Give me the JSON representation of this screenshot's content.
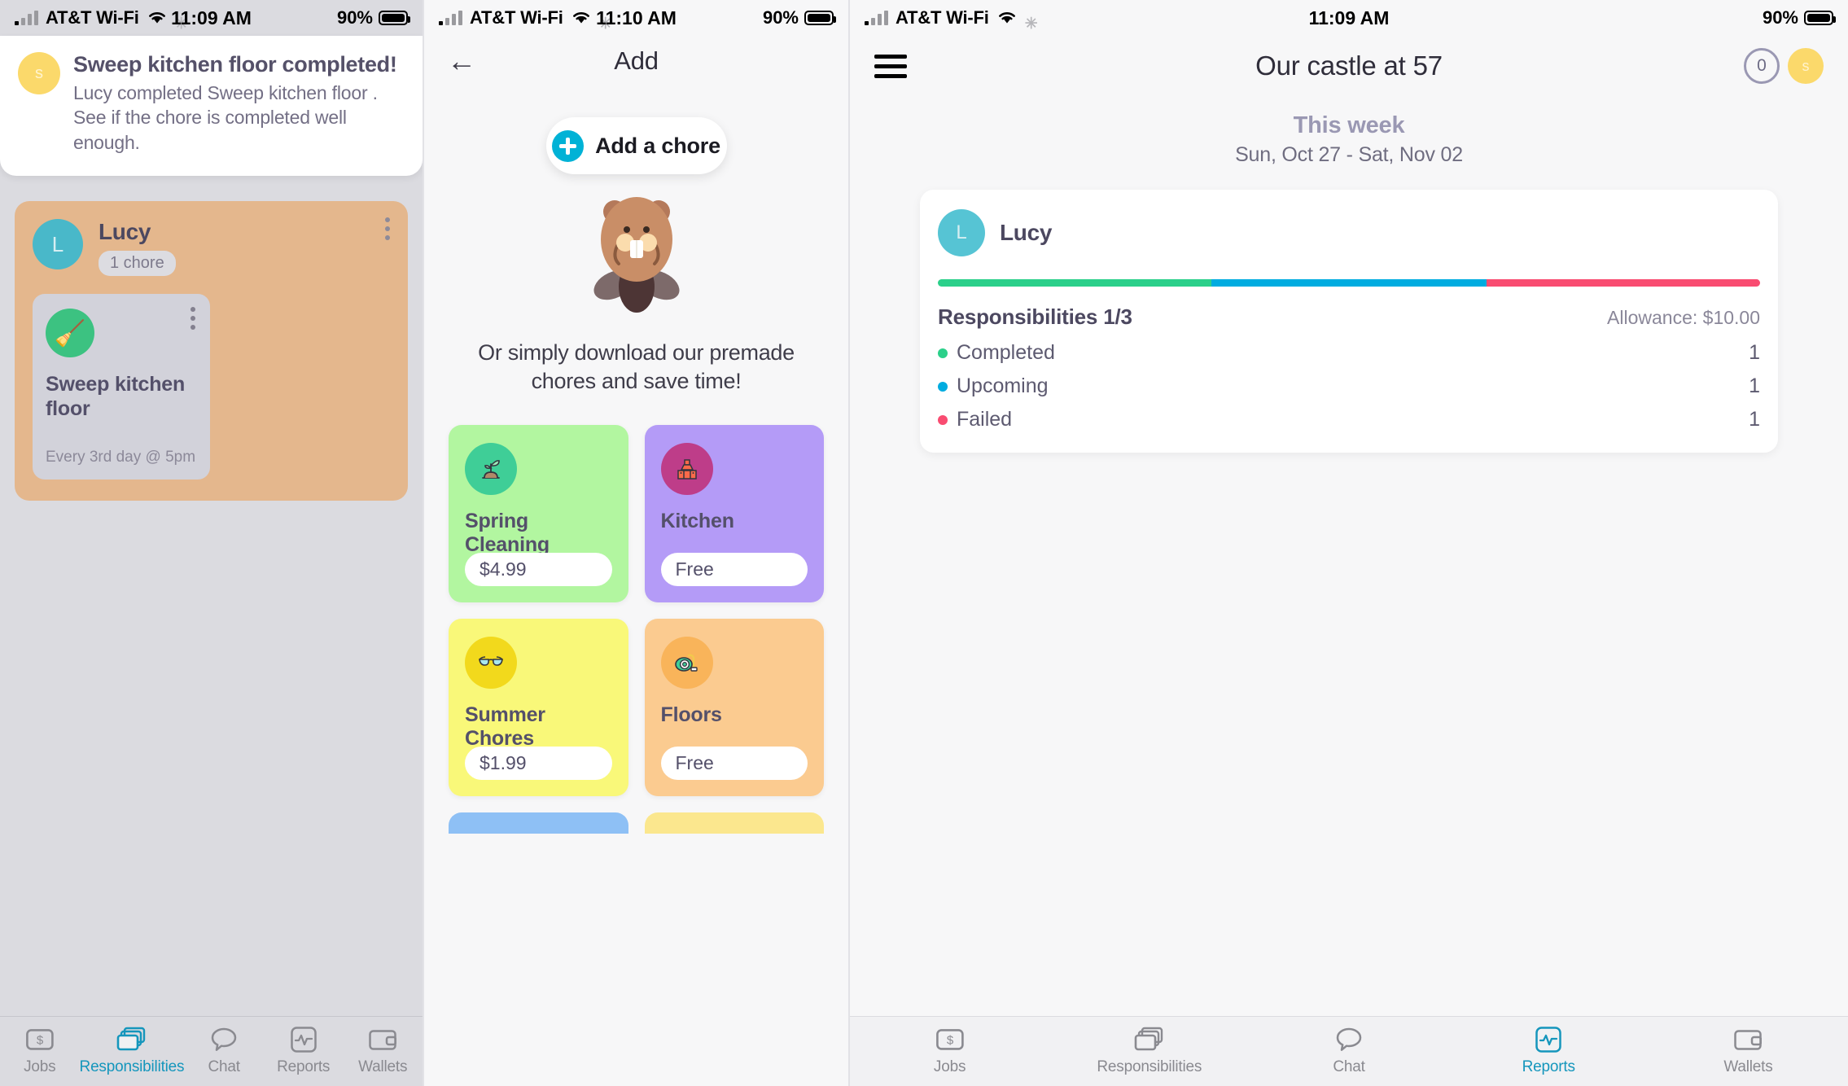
{
  "status_bars": [
    {
      "carrier": "AT&T Wi-Fi",
      "time": "11:09 AM",
      "battery": "90%"
    },
    {
      "carrier": "AT&T Wi-Fi",
      "time": "11:10 AM",
      "battery": "90%"
    },
    {
      "carrier": "AT&T Wi-Fi",
      "time": "11:09 AM",
      "battery": "90%"
    }
  ],
  "screen1": {
    "toast": {
      "avatar_initial": "s",
      "title": "Sweep kitchen floor  completed!",
      "body": "Lucy completed Sweep kitchen floor . See if the chore is completed well enough."
    },
    "member": {
      "avatar_initial": "L",
      "name": "Lucy",
      "chore_count": "1 chore",
      "card_color": "#e4b78d"
    },
    "chore": {
      "icon": "broom-icon",
      "icon_glyph": "🧹",
      "icon_bg": "#3cc281",
      "title": "Sweep kitchen floor",
      "schedule": "Every 3rd day @ 5pm"
    },
    "tabs": [
      {
        "label": "Jobs",
        "icon": "dollar-card-icon",
        "active": false
      },
      {
        "label": "Responsibilities",
        "icon": "stacked-cards-icon",
        "active": true
      },
      {
        "label": "Chat",
        "icon": "speech-bubble-icon",
        "active": false
      },
      {
        "label": "Reports",
        "icon": "pulse-chart-icon",
        "active": false
      },
      {
        "label": "Wallets",
        "icon": "wallet-icon",
        "active": false
      }
    ]
  },
  "screen2": {
    "nav": {
      "back_icon": "back-arrow-icon",
      "title": "Add"
    },
    "add_chore_button": {
      "label": "Add a chore",
      "icon": "plus-circle-icon"
    },
    "mascot": "beaver-mascot",
    "premade_text": "Or simply download our premade chores and save time!",
    "packs": [
      {
        "name": "Spring Cleaning",
        "price": "$4.99",
        "card_bg": "#b2f6a0",
        "icon_bg": "#3fce97",
        "icon": "sprout-icon",
        "icon_glyph": "🌱"
      },
      {
        "name": "Kitchen",
        "price": "Free",
        "card_bg": "#b49bf7",
        "icon_bg": "#be3d89",
        "icon": "kitchen-counter-icon",
        "icon_glyph": "🍳"
      },
      {
        "name": "Summer Chores",
        "price": "$1.99",
        "card_bg": "#f9f879",
        "icon_bg": "#f2d91c",
        "icon": "sunglasses-icon",
        "icon_glyph": "🕶"
      },
      {
        "name": "Floors",
        "price": "Free",
        "card_bg": "#fbcb90",
        "icon_bg": "#f9b košt",
        "icon": "vacuum-icon",
        "icon_glyph": "🧹"
      }
    ],
    "pack_stubs": [
      {
        "card_bg": "#8ec0f5"
      },
      {
        "card_bg": "#fbe78e"
      }
    ]
  },
  "screen3": {
    "nav": {
      "menu_icon": "hamburger-icon",
      "title": "Our castle at 57",
      "coin_count": "0",
      "avatar_initial": "s"
    },
    "week": {
      "title": "This week",
      "range": "Sun, Oct 27 - Sat, Nov 02"
    },
    "report": {
      "avatar_initial": "L",
      "name": "Lucy",
      "responsibilities": "Responsibilities 1/3",
      "allowance": "Allowance: $10.00",
      "bar": [
        {
          "color": "#2bd08a",
          "pct": 33.3
        },
        {
          "color": "#00ace0",
          "pct": 33.4
        },
        {
          "color": "#f94c71",
          "pct": 33.3
        }
      ],
      "rows": [
        {
          "label": "Completed",
          "value": "1",
          "color": "#2bd08a"
        },
        {
          "label": "Upcoming",
          "value": "1",
          "color": "#00ace0"
        },
        {
          "label": "Failed",
          "value": "1",
          "color": "#f94c71"
        }
      ]
    },
    "tabs": [
      {
        "label": "Jobs",
        "icon": "dollar-card-icon",
        "active": false
      },
      {
        "label": "Responsibilities",
        "icon": "stacked-cards-icon",
        "active": false
      },
      {
        "label": "Chat",
        "icon": "speech-bubble-icon",
        "active": false
      },
      {
        "label": "Reports",
        "icon": "pulse-chart-icon",
        "active": true
      },
      {
        "label": "Wallets",
        "icon": "wallet-icon",
        "active": false
      }
    ]
  }
}
